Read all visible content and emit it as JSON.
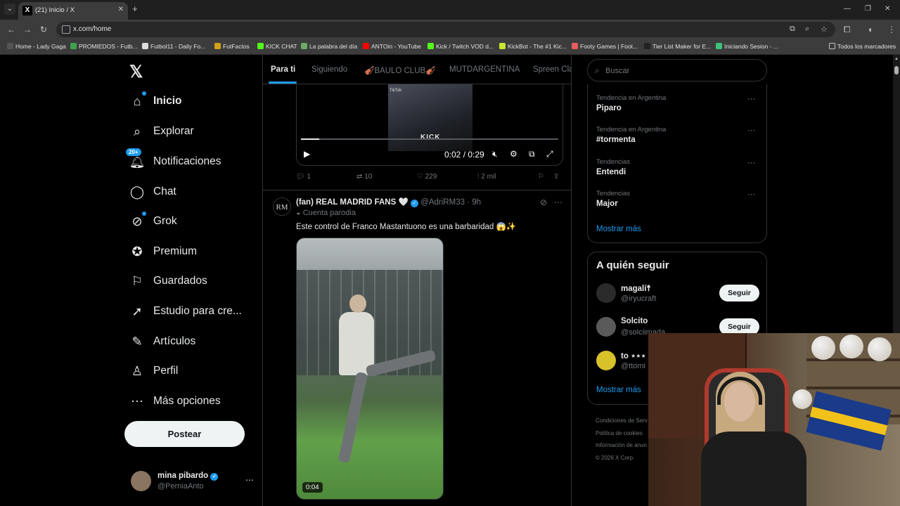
{
  "browser": {
    "tab_title": "(21) Inicio / X",
    "url": "x.com/home",
    "bookmarks": [
      {
        "label": "Home - Lady Gaga",
        "color": "#555555"
      },
      {
        "label": "PROMIEDOS - Futb...",
        "color": "#3fa34d"
      },
      {
        "label": "Futbol11 - Daily Fo...",
        "color": "#dddddd"
      },
      {
        "label": "FutFactos",
        "color": "#d4a017"
      },
      {
        "label": "KICK CHAT",
        "color": "#53fc18"
      },
      {
        "label": "La palabra del día",
        "color": "#6aaa64"
      },
      {
        "label": "ANTOin - YouTube",
        "color": "#ff0000"
      },
      {
        "label": "Kick / Twitch VOD d...",
        "color": "#53fc18"
      },
      {
        "label": "KickBot - The #1 Kic...",
        "color": "#c8e62e"
      },
      {
        "label": "Footy Games | Foot...",
        "color": "#e85d5d"
      },
      {
        "label": "Tier List Maker for E...",
        "color": "#222222"
      },
      {
        "label": "Iniciando Sesion - ...",
        "color": "#3cc07a"
      }
    ],
    "all_bookmarks": "Todos los marcadores"
  },
  "sidebar": {
    "items": [
      {
        "label": "Inicio",
        "icon": "home-icon"
      },
      {
        "label": "Explorar",
        "icon": "search-icon"
      },
      {
        "label": "Notificaciones",
        "icon": "bell-icon",
        "badge": "20+"
      },
      {
        "label": "Chat",
        "icon": "chat-icon"
      },
      {
        "label": "Grok",
        "icon": "grok-icon"
      },
      {
        "label": "Premium",
        "icon": "premium-icon"
      },
      {
        "label": "Guardados",
        "icon": "bookmark-icon"
      },
      {
        "label": "Estudio para cre...",
        "icon": "rocket-icon"
      },
      {
        "label": "Artículos",
        "icon": "article-icon"
      },
      {
        "label": "Perfil",
        "icon": "person-icon"
      },
      {
        "label": "Más opciones",
        "icon": "more-icon"
      }
    ],
    "post_label": "Postear",
    "account": {
      "name": "mina pibardo",
      "handle": "@PerniaAnto"
    }
  },
  "timeline": {
    "tabs": [
      "Para ti",
      "Siguiendo",
      "🎻BAULO CLUB🎻",
      "MUTDARGENTINA",
      "Spreen Cla"
    ],
    "video1": {
      "time": "0:02 / 0:29",
      "progress": 0.07,
      "overlay_text": "KICK",
      "watermark": "TikTok"
    },
    "actions1": {
      "replies": "1",
      "reposts": "10",
      "likes": "229",
      "views": "2 mil"
    },
    "tweet": {
      "avatar_text": "RM",
      "name": "(fan) REAL MADRID FANS 🤍",
      "handle_time": "@AdriRM33 · 9h",
      "parody": "Cuenta parodia",
      "text": "Este control de Franco Mastantuono es una barbaridad 😱✨",
      "duration": "0:04"
    }
  },
  "right": {
    "search_placeholder": "Buscar",
    "trends": [
      {
        "context": "Tendencia en Argentina",
        "name": "Piparo"
      },
      {
        "context": "Tendencia en Argentina",
        "name": "#tormenta"
      },
      {
        "context": "Tendencias",
        "name": "Entendi"
      },
      {
        "context": "Tendencias",
        "name": "Major"
      }
    ],
    "show_more": "Mostrar más",
    "who_title": "A quién seguir",
    "suggestions": [
      {
        "name": "magalí☨",
        "handle": "@iryucraft",
        "color": "#222222"
      },
      {
        "name": "Solcito",
        "handle": "@solciimada",
        "color": "#5a5a5a"
      },
      {
        "name": "to ⋆⋆⋆",
        "handle": "@ttomi",
        "color": "#d8c22a"
      }
    ],
    "follow_label": "Seguir",
    "show_more2": "Mostrar más",
    "footer": [
      "Condiciones de Serv",
      "Política de cookies",
      "Información de anun",
      "© 2026 X Corp."
    ]
  }
}
